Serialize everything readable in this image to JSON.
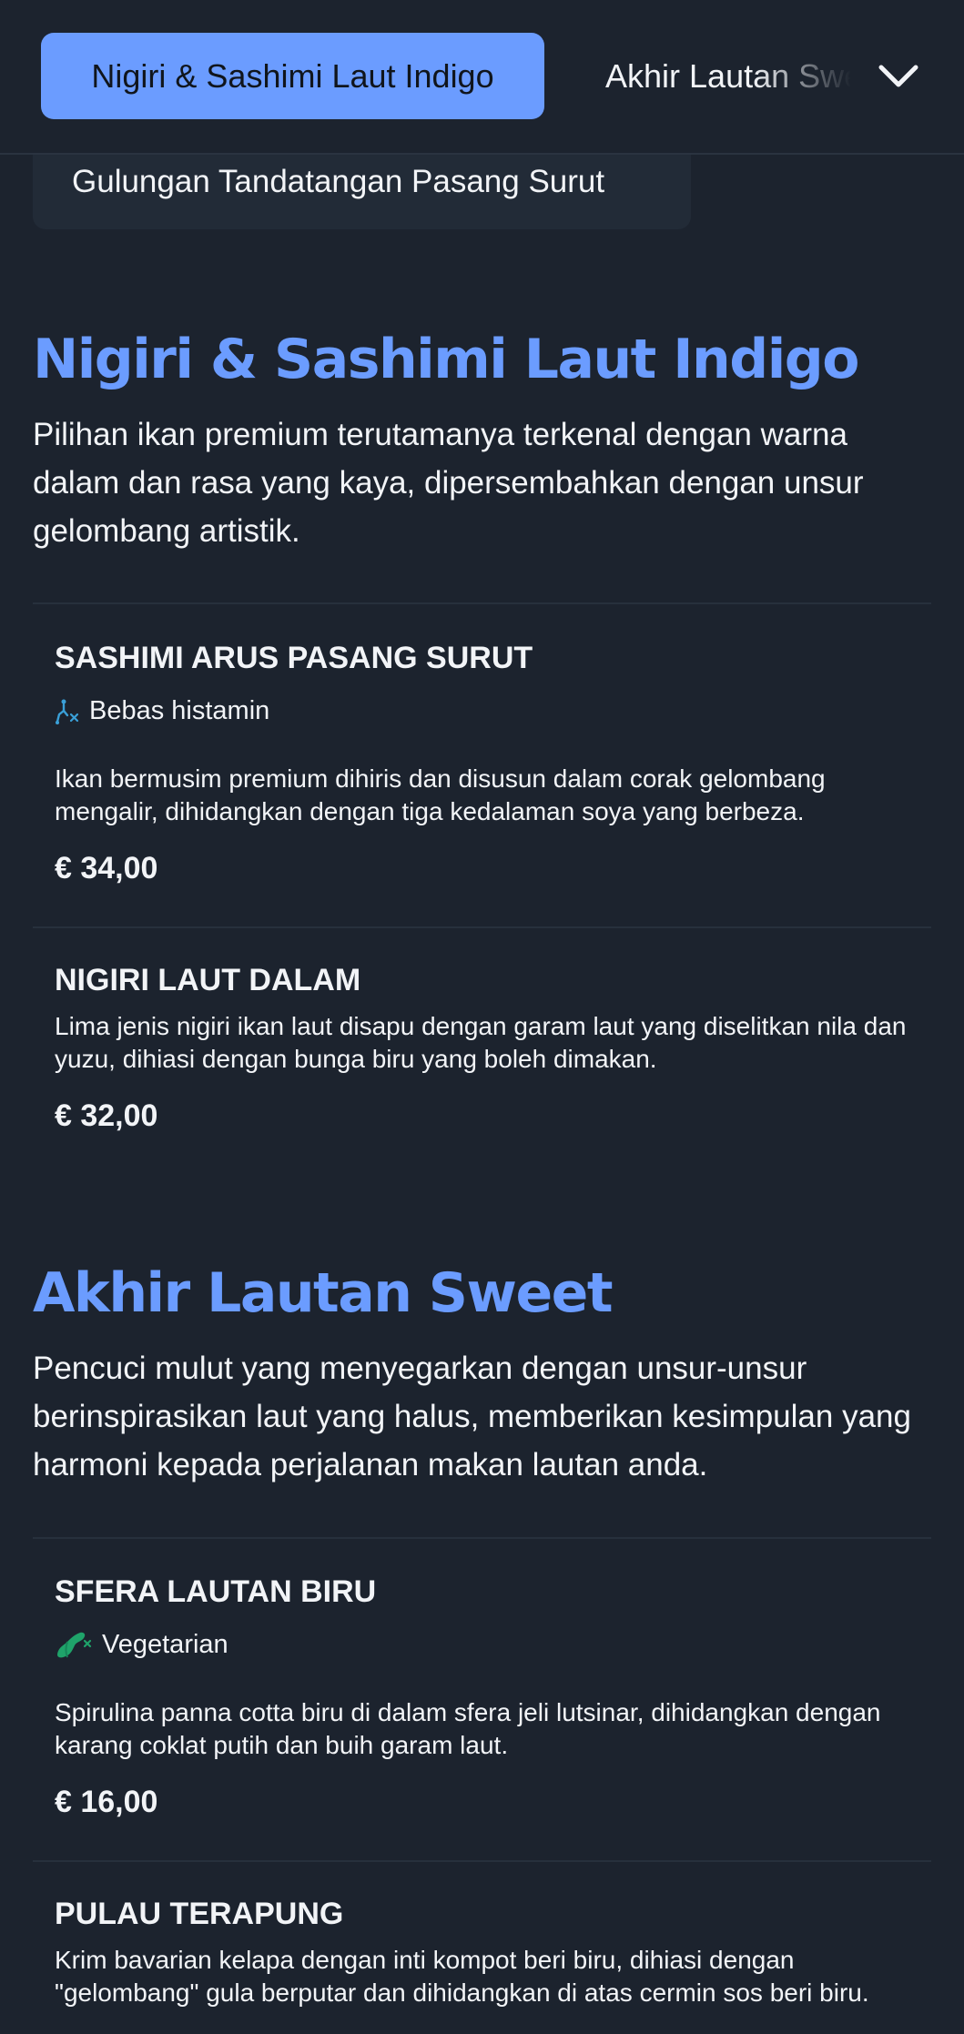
{
  "nav": {
    "active_tab": "Nigiri & Sashimi Laut Indigo",
    "next_tab": "Akhir Lautan Sweet",
    "previous_tab": "Gulungan Tandatangan Pasang Surut"
  },
  "sections": [
    {
      "title": "Nigiri & Sashimi Laut Indigo",
      "description": "Pilihan ikan premium terutamanya terkenal dengan warna dalam dan rasa yang kaya, dipersembahkan dengan unsur gelombang artistik.",
      "items": [
        {
          "name": "SASHIMI ARUS PASANG SURUT",
          "badge": "Bebas histamin",
          "badge_icon": "histamine-free-icon",
          "badge_color": "#3aa0d8",
          "description": "Ikan bermusim premium dihiris dan disusun dalam corak gelombang mengalir, dihidangkan dengan tiga kedalaman soya yang berbeza.",
          "price": "€ 34,00"
        },
        {
          "name": "NIGIRI LAUT DALAM",
          "description": "Lima jenis nigiri ikan laut disapu dengan garam laut yang diselitkan nila dan yuzu, dihiasi dengan bunga biru yang boleh dimakan.",
          "price": "€ 32,00"
        }
      ]
    },
    {
      "title": "Akhir Lautan Sweet",
      "description": "Pencuci mulut yang menyegarkan dengan unsur-unsur berinspirasikan laut yang halus, memberikan kesimpulan yang harmoni kepada perjalanan makan lautan anda.",
      "items": [
        {
          "name": "SFERA LAUTAN BIRU",
          "badge": "Vegetarian",
          "badge_icon": "vegetarian-icon",
          "badge_color": "#1fa36a",
          "description": "Spirulina panna cotta biru di dalam sfera jeli lutsinar, dihidangkan dengan karang coklat putih dan buih garam laut.",
          "price": "€ 16,00"
        },
        {
          "name": "PULAU TERAPUNG",
          "description": "Krim bavarian kelapa dengan inti kompot beri biru, dihiasi dengan \"gelombang\" gula berputar dan dihidangkan di atas cermin sos beri biru.",
          "price": ""
        }
      ]
    }
  ],
  "colors": {
    "background": "#1c232e",
    "accent": "#6b9cff",
    "pill_background": "#222b37",
    "divider": "#27303c"
  }
}
